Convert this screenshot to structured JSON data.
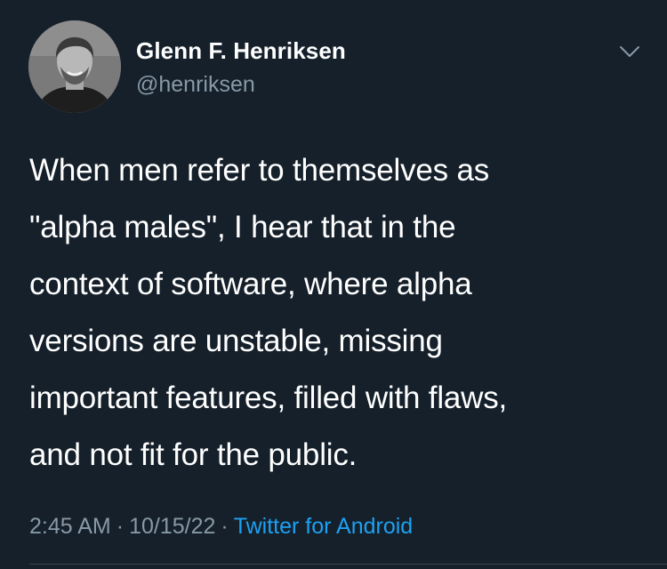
{
  "author": {
    "display_name": "Glenn F. Henriksen",
    "handle": "@henriksen",
    "avatar_icon": "profile-photo"
  },
  "tweet": {
    "lines": [
      "When men refer to themselves as",
      "\"alpha males\", I hear that in the",
      "context of software, where alpha",
      "versions are unstable, missing",
      "important features, filled with flaws,",
      "and not fit for the public."
    ]
  },
  "meta": {
    "time": "2:45 AM",
    "separator": "·",
    "date": "10/15/22",
    "source": "Twitter for Android"
  },
  "colors": {
    "background": "#15202b",
    "text": "#ffffff",
    "secondary": "#8899a6",
    "link": "#1da1f2"
  }
}
